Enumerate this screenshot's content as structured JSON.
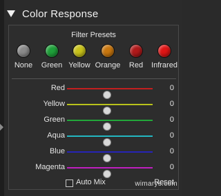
{
  "header": {
    "title": "Color Response"
  },
  "presets": {
    "title": "Filter Presets",
    "items": [
      {
        "label": "None",
        "color": "#8a8a8a"
      },
      {
        "label": "Green",
        "color": "#1fa03a"
      },
      {
        "label": "Yellow",
        "color": "#c8c21a"
      },
      {
        "label": "Orange",
        "color": "#c9770f"
      },
      {
        "label": "Red",
        "color": "#b0191a"
      },
      {
        "label": "Infrared",
        "color": "#e01515"
      }
    ]
  },
  "sliders": [
    {
      "label": "Red",
      "value": "0",
      "color": "#c41f1f"
    },
    {
      "label": "Yellow",
      "value": "0",
      "color": "#b9c21b"
    },
    {
      "label": "Green",
      "value": "0",
      "color": "#22a83a"
    },
    {
      "label": "Aqua",
      "value": "0",
      "color": "#23b7c2"
    },
    {
      "label": "Blue",
      "value": "0",
      "color": "#2624b8"
    },
    {
      "label": "Magenta",
      "value": "0",
      "color": "#c01fc1"
    }
  ],
  "footer": {
    "automix_label": "Auto Mix",
    "automix_checked": false,
    "reset_label": "Reset"
  },
  "watermark": "wimarys.com"
}
